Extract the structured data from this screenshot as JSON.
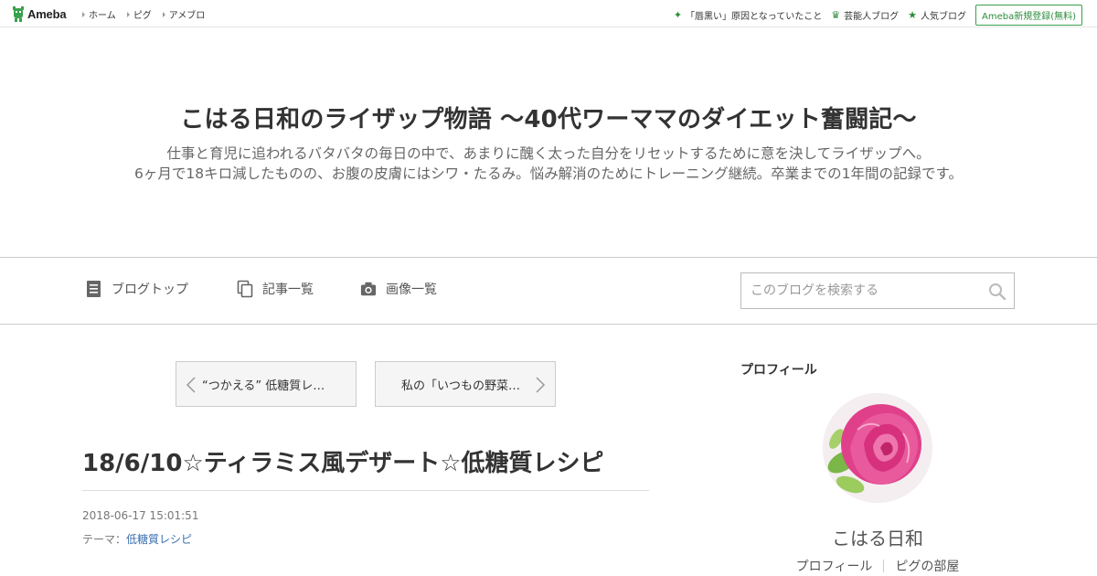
{
  "topbar": {
    "logo": "Ameba",
    "nav": [
      "ホーム",
      "ピグ",
      "アメブロ"
    ],
    "right_links": [
      {
        "label": "「唇黒い」原因となっていたこと",
        "icon": "sparkle-icon"
      },
      {
        "label": "芸能人ブログ",
        "icon": "crown-icon"
      },
      {
        "label": "人気ブログ",
        "icon": "star-icon"
      }
    ],
    "signup": "Ameba新規登録(無料)"
  },
  "header": {
    "title": "こはる日和のライザップ物語 〜40代ワーママのダイエット奮闘記〜",
    "desc_line1": "仕事と育児に追われるバタバタの毎日の中で、あまりに醜く太った自分をリセットするために意を決してライザップへ。",
    "desc_line2": "6ヶ月で18キロ減したものの、お腹の皮膚にはシワ・たるみ。悩み解消のためにトレーニング継続。卒業までの1年間の記録です。"
  },
  "nav": {
    "items": [
      "ブログトップ",
      "記事一覧",
      "画像一覧"
    ],
    "search_placeholder": "このブログを検索する"
  },
  "pager": {
    "prev": "“つかえる” 低糖質レ…",
    "next": "私の「いつもの野菜…"
  },
  "entry": {
    "title": "18/6/10☆ティラミス風デザート☆低糖質レシピ",
    "date": "2018-06-17 15:01:51",
    "theme_label": "テーマ：",
    "theme_value": "低糖質レシピ"
  },
  "sidebar": {
    "heading": "プロフィール",
    "name": "こはる日和",
    "links": [
      "プロフィール",
      "ピグの部屋"
    ]
  },
  "colors": {
    "accent_green": "#2d8c3c",
    "link_blue": "#3a6fb0",
    "avatar_rose": "#e0408a"
  }
}
